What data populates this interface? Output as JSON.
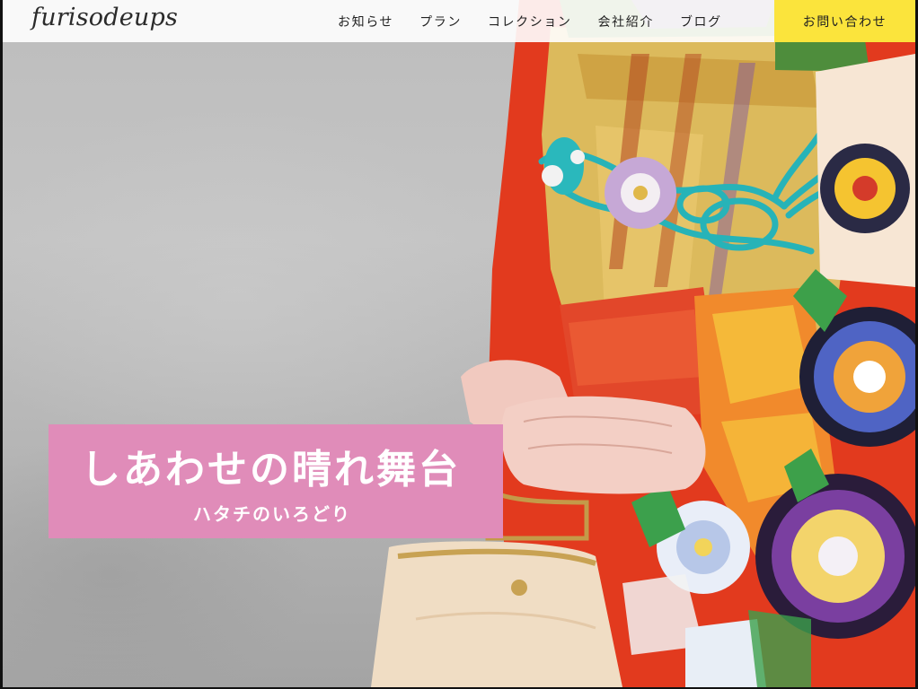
{
  "header": {
    "logo": "furisodeups",
    "nav": [
      {
        "label": "お知らせ"
      },
      {
        "label": "プラン"
      },
      {
        "label": "コレクション"
      },
      {
        "label": "会社紹介"
      },
      {
        "label": "ブログ"
      }
    ],
    "contact_label": "お問い合わせ"
  },
  "hero": {
    "title": "しあわせの晴れ舞台",
    "subtitle": "ハタチのいろどり"
  },
  "colors": {
    "contact_button_bg": "#fbe43c",
    "catch_box_bg": "#e08cb9",
    "kimono_red": "#e8371f",
    "obi_gold": "#d9b85a",
    "cord_teal": "#27b3b8"
  },
  "icons": {
    "logo": "furisodeups-logo"
  }
}
